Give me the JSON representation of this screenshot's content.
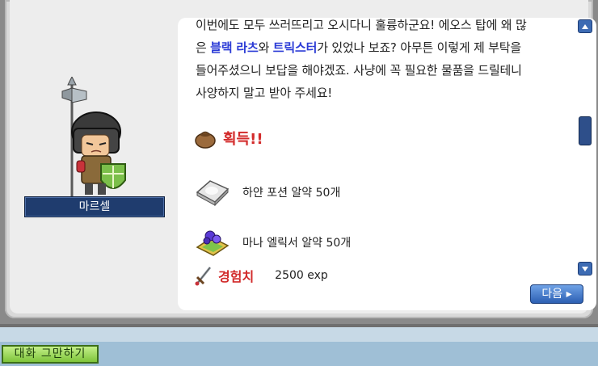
{
  "npc": {
    "name": "마르셀"
  },
  "dialog": {
    "lines": [
      {
        "parts": [
          {
            "t": "이번에도 모두 쓰러뜨리고 오시다니 훌륭하군요! 에오스 탑에 왜 많",
            "hl": false
          }
        ]
      },
      {
        "parts": [
          {
            "t": "은 ",
            "hl": false
          },
          {
            "t": "블랙 라츠",
            "hl": true
          },
          {
            "t": "와 ",
            "hl": false
          },
          {
            "t": "트릭스터",
            "hl": true
          },
          {
            "t": "가 있었나 보죠? 아무튼 이렇게 제 부탁을",
            "hl": false
          }
        ]
      },
      {
        "parts": [
          {
            "t": "들어주셨으니 보답을 해야겠죠. 사냥에 꼭 필요한 물품을 드릴테니",
            "hl": false
          }
        ]
      },
      {
        "parts": [
          {
            "t": "사양하지 말고 받아 주세요!",
            "hl": false
          }
        ]
      }
    ],
    "reward_title": "획득!!",
    "rewards": [
      {
        "icon": "white-potion-icon",
        "label": "하얀 포션 알약 50개"
      },
      {
        "icon": "mana-elixir-icon",
        "label": "마나 엘릭서 알약 50개"
      }
    ],
    "exp_label": "경험치",
    "exp_value": "2500 exp"
  },
  "buttons": {
    "next": "다음 ▸",
    "end_chat": "대화 그만하기"
  },
  "colors": {
    "highlight": "#2b3bd6",
    "reward_red": "#d22b2b",
    "npc_name_bg": "#1f3c6e",
    "next_button": "#3d6bb3",
    "end_button": "#7ec43a"
  }
}
